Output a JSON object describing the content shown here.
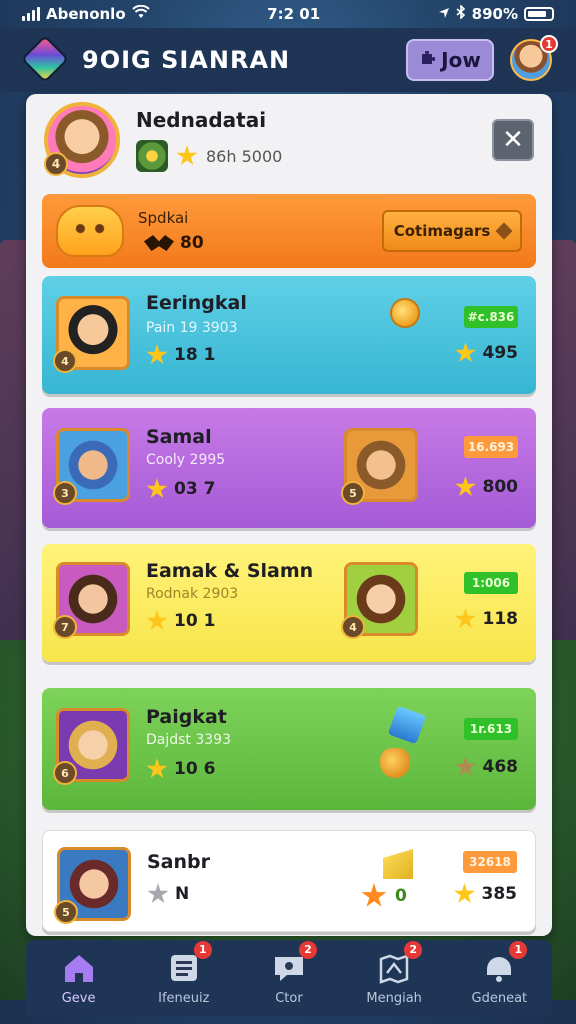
{
  "status_bar": {
    "carrier": "Abenonlo",
    "time": "7:2 01",
    "battery": "890%"
  },
  "header": {
    "title": "9OIG SIANRAN",
    "show_button": "Jow",
    "avatar_badge": "1"
  },
  "profile": {
    "name": "Nednadatai",
    "stat": "86h 5000",
    "close_label": "✕",
    "level": "4"
  },
  "promo": {
    "title": "Spdkai",
    "count": "80",
    "button_label": "Cotimagars"
  },
  "players": [
    {
      "name": "Eeringkal",
      "sub": "Pain 19 3903",
      "stars": "18 1",
      "tag": "#c.836",
      "right_stars": "495",
      "level": "4",
      "color": "#37b5d2"
    },
    {
      "name": "Samal",
      "sub": "Cooly 2995",
      "stars": "03 7",
      "tag": "16.693",
      "right_stars": "800",
      "level": "3",
      "second_level": "5",
      "color": "#a55ad6"
    },
    {
      "name": "Eamak & Slamn",
      "sub": "Rodnak 2903",
      "stars": "10 1",
      "tag": "1:006",
      "right_stars": "118",
      "level": "7",
      "second_level": "4",
      "color": "#f7e54a"
    },
    {
      "name": "Paigkat",
      "sub": "Dajdst 3393",
      "stars": "10 6",
      "tag": "1r.613",
      "right_stars": "468",
      "level": "6",
      "color": "#5db63c"
    },
    {
      "name": "Sanbr",
      "stars": "N",
      "middle_value": "0",
      "tag": "32618",
      "right_stars": "385",
      "level": "5"
    }
  ],
  "bottom_nav": [
    {
      "label": "Geve",
      "icon": "home-icon",
      "badge": ""
    },
    {
      "label": "Ifeneuiz",
      "icon": "list-icon",
      "badge": "1"
    },
    {
      "label": "Ctor",
      "icon": "chat-icon",
      "badge": "2"
    },
    {
      "label": "Mengiah",
      "icon": "map-icon",
      "badge": "2"
    },
    {
      "label": "Gdeneat",
      "icon": "bell-icon",
      "badge": "1"
    }
  ]
}
